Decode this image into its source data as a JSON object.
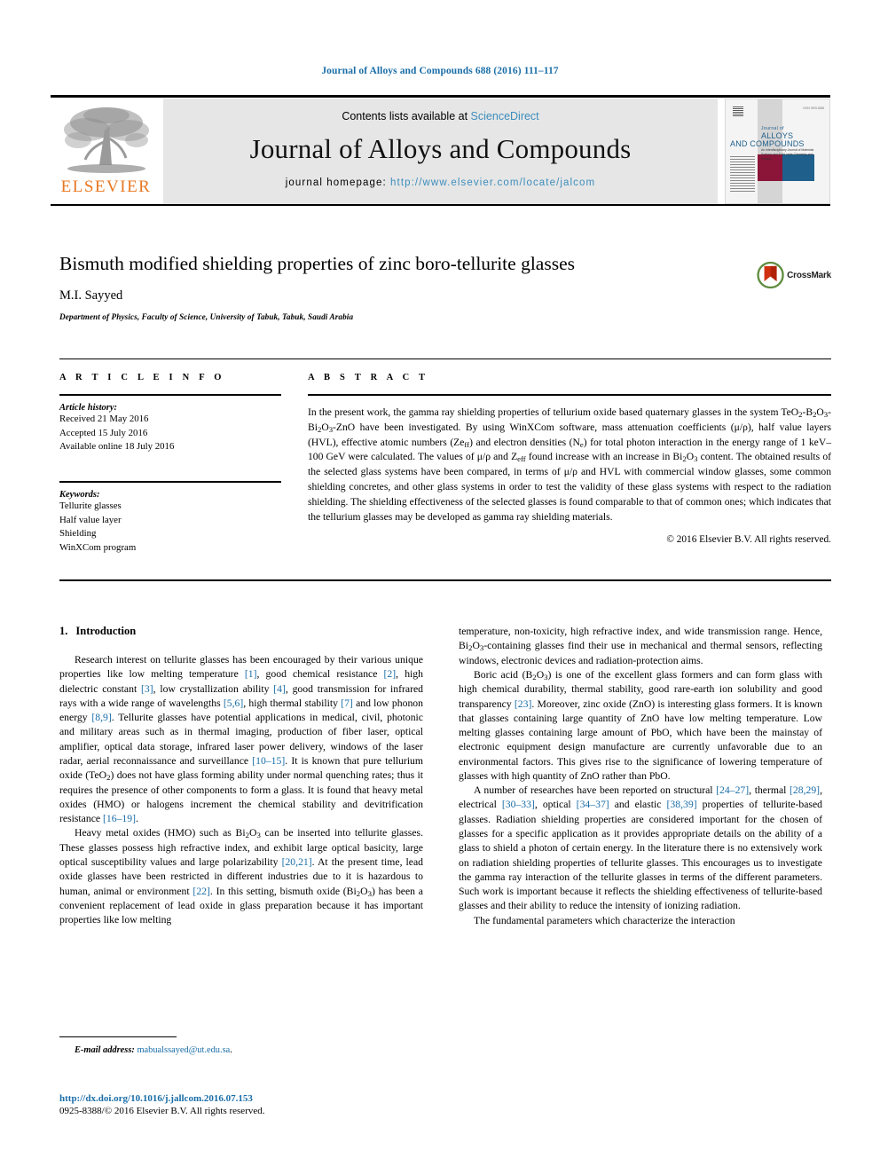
{
  "running_head": "Journal of Alloys and Compounds 688 (2016) 111–117",
  "masthead": {
    "publisher_name": "ELSEVIER",
    "contents_prefix": "Contents lists available at",
    "sciencedirect": "ScienceDirect",
    "journal_name": "Journal of Alloys and Compounds",
    "homepage_label": "journal homepage:",
    "homepage_url": "http://www.elsevier.com/locate/jalcom",
    "cover": {
      "line1": "Journal of",
      "line2": "ALLOYS",
      "line3": "AND COMPOUNDS",
      "subtitle": "An Interdisciplinary Journal of Materials Science and Solid-state Chemistry and Physics",
      "corner_note": "ISSN 0925-8388"
    },
    "accent_blue": "#3c8dbc",
    "elsevier_orange": "#e87722"
  },
  "article": {
    "title": "Bismuth modified shielding properties of zinc boro-tellurite glasses",
    "authors": "M.I. Sayyed",
    "affiliation": "Department of Physics, Faculty of Science, University of Tabuk, Tabuk, Saudi Arabia",
    "crossmark_label": "CrossMark"
  },
  "article_info": {
    "heading": "A R T I C L E   I N F O",
    "history_label": "Article history:",
    "history": [
      "Received 21 May 2016",
      "Accepted 15 July 2016",
      "Available online 18 July 2016"
    ],
    "keywords_label": "Keywords:",
    "keywords": [
      "Tellurite glasses",
      "Half value layer",
      "Shielding",
      "WinXCom program"
    ]
  },
  "abstract": {
    "heading": "A B S T R A C T",
    "copyright": "© 2016 Elsevier B.V. All rights reserved."
  },
  "body": {
    "section1_number": "1.",
    "section1_title": "Introduction"
  },
  "footnote": {
    "email_label": "E-mail address:",
    "email": "mabualssayed@ut.edu.sa"
  },
  "imprint": {
    "doi": "http://dx.doi.org/10.1016/j.jallcom.2016.07.153",
    "issn_line": "0925-8388/© 2016 Elsevier B.V. All rights reserved."
  },
  "colors": {
    "link_blue": "#1a6ea8",
    "header_blue": "#1a6ea8",
    "band_gray": "#e6e6e6",
    "cover_maroon": "#8a1538",
    "cover_blue": "#1f5f8b"
  }
}
